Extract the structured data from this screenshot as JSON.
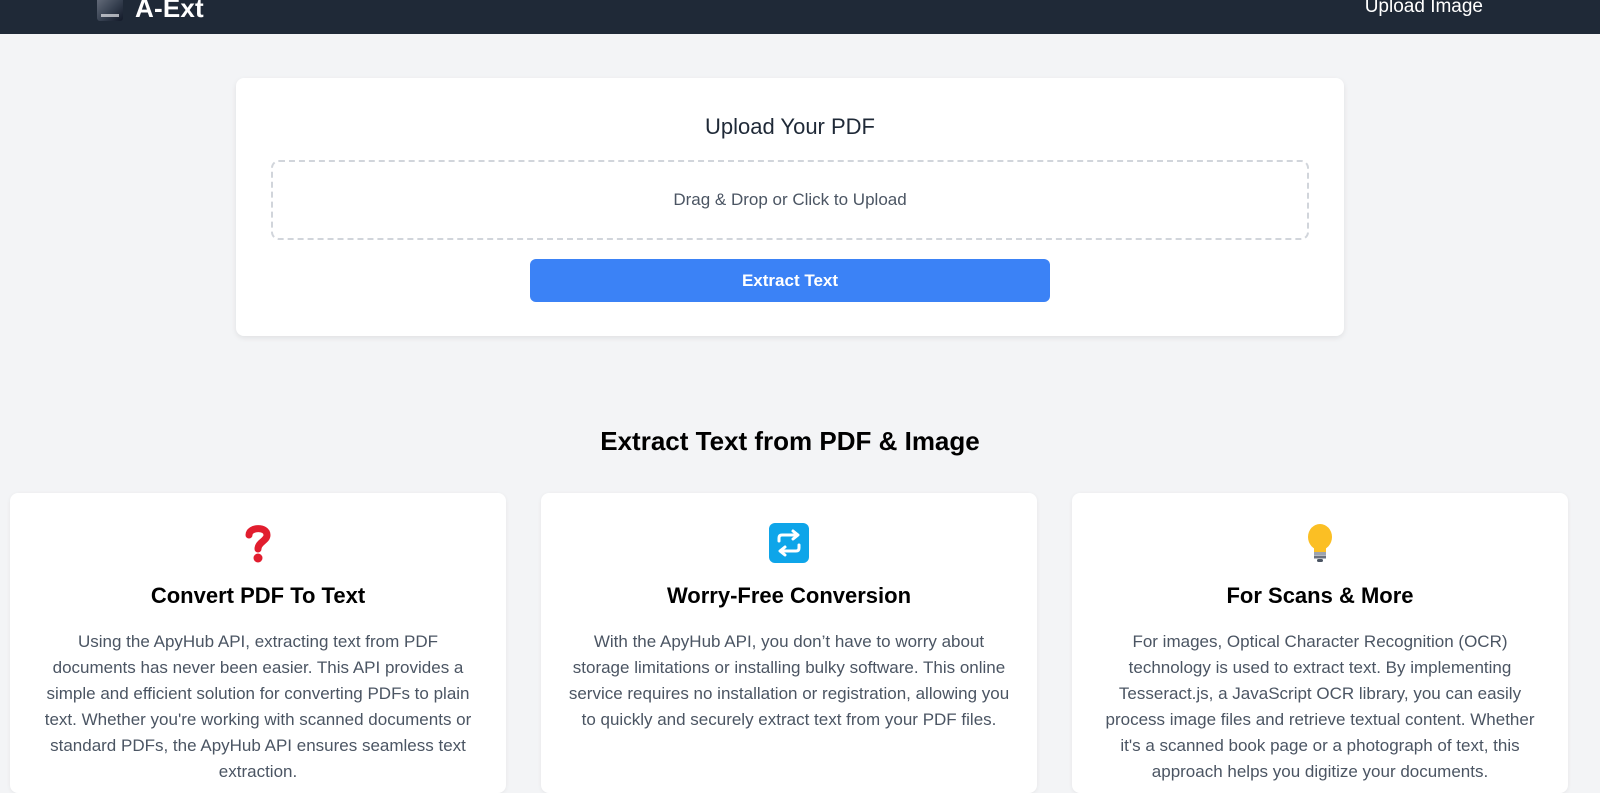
{
  "navbar": {
    "brand": "A-Ext",
    "link": "Upload Image"
  },
  "upload": {
    "title": "Upload Your PDF",
    "dropzone_text": "Drag & Drop or Click to Upload",
    "button_label": "Extract Text"
  },
  "section_title": "Extract Text from PDF & Image",
  "features": [
    {
      "icon": "question-mark-icon",
      "title": "Convert PDF To Text",
      "text": "Using the ApyHub API, extracting text from PDF documents has never been easier. This API provides a simple and efficient solution for converting PDFs to plain text. Whether you're working with scanned documents or standard PDFs, the ApyHub API ensures seamless text extraction."
    },
    {
      "icon": "repeat-arrows-icon",
      "title": "Worry-Free Conversion",
      "text": "With the ApyHub API, you don’t have to worry about storage limitations or installing bulky software. This online service requires no installation or registration, allowing you to quickly and securely extract text from your PDF files."
    },
    {
      "icon": "light-bulb-icon",
      "title": "For Scans & More",
      "text": "For images, Optical Character Recognition (OCR) technology is used to extract text. By implementing Tesseract.js, a JavaScript OCR library, you can easily process image files and retrieve textual content. Whether it's a scanned book page or a photograph of text, this approach helps you digitize your documents."
    }
  ],
  "colors": {
    "navbar": "#1f2937",
    "accent": "#3b82f6",
    "background": "#f3f4f6"
  }
}
